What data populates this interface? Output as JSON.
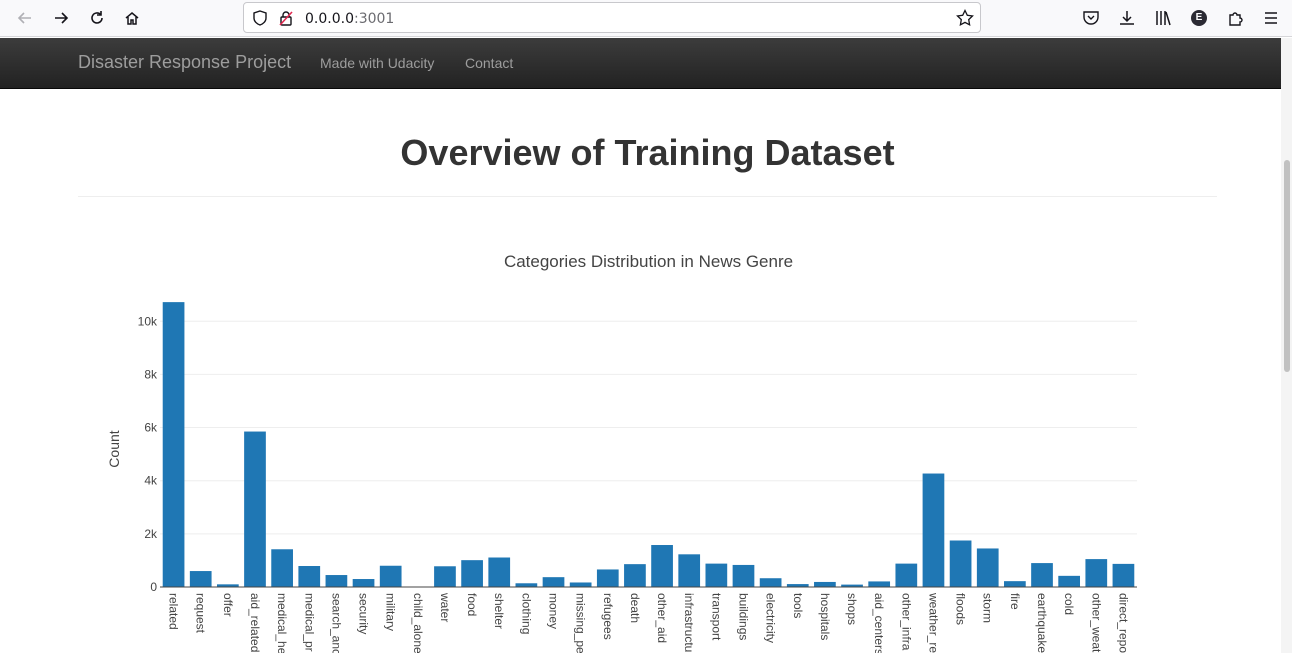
{
  "browser": {
    "url_host": "0.0.0.0",
    "url_port": ":3001",
    "account_initial": "E"
  },
  "navbar": {
    "brand": "Disaster Response Project",
    "links": [
      "Made with Udacity",
      "Contact"
    ]
  },
  "page": {
    "title": "Overview of Training Dataset"
  },
  "colors": {
    "bar": "#1f77b4",
    "navbar": "#222222"
  },
  "chart_data": {
    "type": "bar",
    "title": "Categories Distribution in News Genre",
    "xlabel": "",
    "ylabel": "Count",
    "ylim": [
      0,
      10800
    ],
    "yticks": [
      0,
      2000,
      4000,
      6000,
      8000,
      10000
    ],
    "ytick_labels": [
      "0",
      "2k",
      "4k",
      "6k",
      "8k",
      "10k"
    ],
    "grid": true,
    "categories": [
      "related",
      "request",
      "offer",
      "aid_related",
      "medical_he",
      "medical_pr",
      "search_anc",
      "security",
      "military",
      "child_alone",
      "water",
      "food",
      "shelter",
      "clothing",
      "money",
      "missing_pe",
      "refugees",
      "death",
      "other_aid",
      "infrastructu",
      "transport",
      "buildings",
      "electricity",
      "tools",
      "hospitals",
      "shops",
      "aid_centers",
      "other_infra",
      "weather_re",
      "floods",
      "storm",
      "fire",
      "earthquake",
      "cold",
      "other_weat",
      "direct_repo"
    ],
    "values": [
      10720,
      600,
      100,
      5850,
      1420,
      790,
      450,
      300,
      800,
      0,
      780,
      1010,
      1110,
      140,
      370,
      170,
      660,
      860,
      1580,
      1230,
      880,
      830,
      330,
      110,
      190,
      90,
      210,
      880,
      4270,
      1750,
      1450,
      220,
      900,
      420,
      1050,
      870
    ]
  }
}
